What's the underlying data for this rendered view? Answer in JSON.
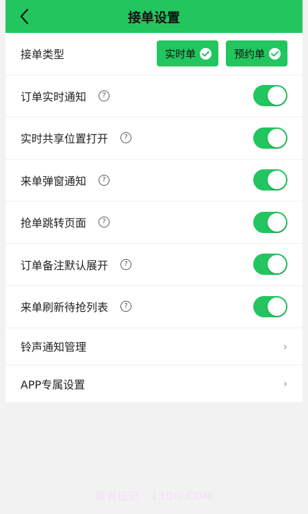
{
  "header": {
    "title": "接单设置",
    "back_icon": "chevron-left-icon"
  },
  "order_type": {
    "label": "接单类型",
    "options": [
      {
        "label": "实时单",
        "checked": true
      },
      {
        "label": "预约单",
        "checked": true
      }
    ]
  },
  "toggles": [
    {
      "label": "订单实时通知",
      "on": true
    },
    {
      "label": "实时共享位置打开",
      "on": true
    },
    {
      "label": "来单弹窗通知",
      "on": true
    },
    {
      "label": "抢单跳转页面",
      "on": true
    },
    {
      "label": "订单备注默认展开",
      "on": true
    },
    {
      "label": "来单刷新待抢列表",
      "on": true
    }
  ],
  "help_glyph": "?",
  "links": [
    {
      "label": "铃声通知管理"
    },
    {
      "label": "APP专属设置"
    }
  ],
  "chevron_glyph": "›",
  "watermark": "藏者日记 · 13DIY.COM",
  "colors": {
    "accent": "#22c55e",
    "background": "#f2f2f2"
  }
}
